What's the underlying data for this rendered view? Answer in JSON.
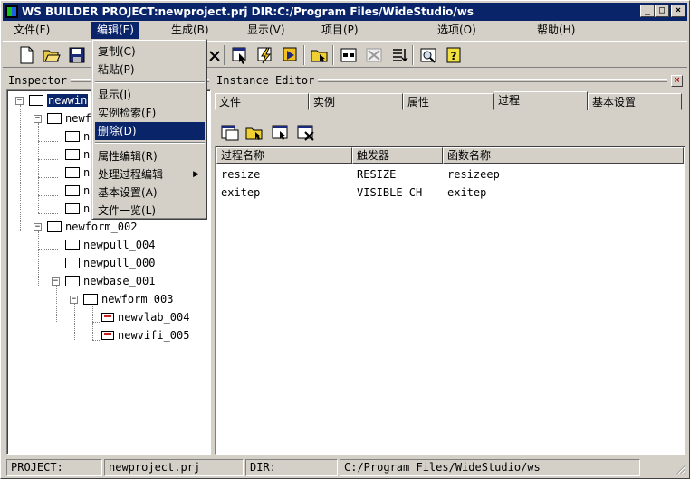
{
  "window": {
    "title": "WS BUILDER PROJECT:newproject.prj DIR:C:/Program Files/WideStudio/ws",
    "minimize_label": "_",
    "maximize_label": "□",
    "close_label": "×"
  },
  "menubar": {
    "items": [
      {
        "label": "文件(F)"
      },
      {
        "label": "编辑(E)"
      },
      {
        "label": "生成(B)"
      },
      {
        "label": "显示(V)"
      },
      {
        "label": "项目(P)"
      },
      {
        "label": "选项(O)"
      },
      {
        "label": "帮助(H)"
      }
    ]
  },
  "edit_menu": {
    "items": [
      {
        "label": "复制(C)"
      },
      {
        "label": "粘贴(P)"
      },
      {
        "label": "显示(I)"
      },
      {
        "label": "实例检索(F)"
      },
      {
        "label": "删除(D)"
      },
      {
        "label": "属性编辑(R)"
      },
      {
        "label": "处理过程编辑"
      },
      {
        "label": "基本设置(A)"
      },
      {
        "label": "文件一览(L)"
      }
    ],
    "highlighted": "删除(D)",
    "submenu_arrow": "▶"
  },
  "inspector": {
    "title": "Inspector",
    "tree": [
      {
        "label": "newwin",
        "level": 0
      },
      {
        "label": "newf",
        "level": 1
      },
      {
        "label": "n",
        "level": 2
      },
      {
        "label": "n",
        "level": 2
      },
      {
        "label": "n",
        "level": 2
      },
      {
        "label": "n",
        "level": 2
      },
      {
        "label": "n",
        "level": 2
      },
      {
        "label": "newform_002",
        "level": 1
      },
      {
        "label": "newpull_004",
        "level": 2
      },
      {
        "label": "newpull_000",
        "level": 2
      },
      {
        "label": "newbase_001",
        "level": 2
      },
      {
        "label": "newform_003",
        "level": 3
      },
      {
        "label": "newvlab_004",
        "level": 4
      },
      {
        "label": "newvifi_005",
        "level": 4
      }
    ],
    "expand_label": "−"
  },
  "instance_editor": {
    "title": "Instance Editor",
    "close_label": "×",
    "tabs": [
      {
        "label": "文件"
      },
      {
        "label": "实例"
      },
      {
        "label": "属性"
      },
      {
        "label": "过程"
      },
      {
        "label": "基本设置"
      }
    ],
    "active_tab": "过程",
    "columns": [
      "过程名称",
      "触发器",
      "函数名称"
    ],
    "rows": [
      [
        "resize",
        "RESIZE",
        "resizeep"
      ],
      [
        "exitep",
        "VISIBLE-CH",
        "exitep"
      ]
    ]
  },
  "status_bar": {
    "project_label": "PROJECT:",
    "project_value": "newproject.prj",
    "dir_label": "DIR:",
    "dir_value": "C:/Program Files/WideStudio/ws"
  }
}
